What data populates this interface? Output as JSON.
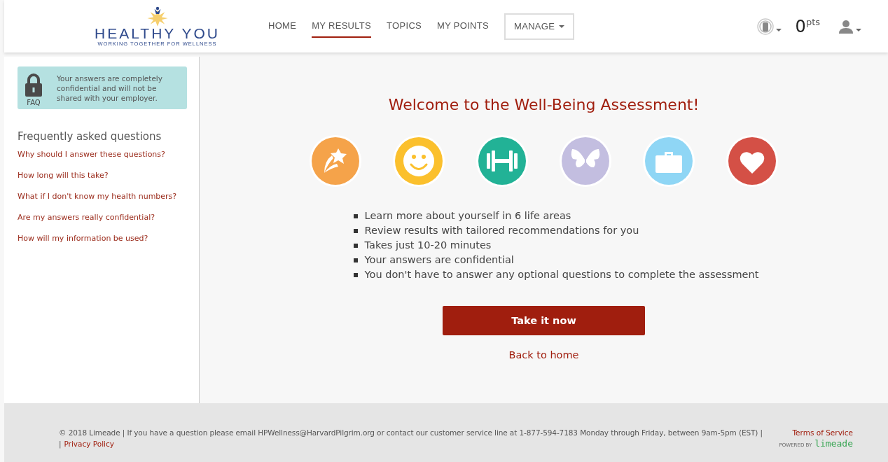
{
  "header": {
    "logo": {
      "title": "HEALTHY YOU",
      "tagline": "WORKING TOGETHER FOR WELLNESS"
    },
    "nav": [
      {
        "label": "HOME",
        "selected": false
      },
      {
        "label": "MY RESULTS",
        "selected": true
      },
      {
        "label": "TOPICS",
        "selected": false
      },
      {
        "label": "MY POINTS",
        "selected": false
      }
    ],
    "manage_menu": {
      "label": "MANAGE"
    },
    "points": {
      "value": "0",
      "unit": "pts"
    }
  },
  "sidebar": {
    "notice": {
      "icon_label": "FAQ",
      "text": "Your answers are completely confidential and will not be shared with your employer."
    },
    "faq_title": "Frequently asked questions",
    "faq_links": [
      "Why should I answer these questions?",
      "How long will this take?",
      "What if I don't know my health numbers?",
      "Are my answers really confidential?",
      "How will my information be used?"
    ]
  },
  "main": {
    "title": "Welcome to the Well-Being Assessment!",
    "areas": [
      {
        "kind": "star",
        "color": "#f5a34a"
      },
      {
        "kind": "smiley",
        "color": "#fbc02d"
      },
      {
        "kind": "dumbbell",
        "color": "#22b296"
      },
      {
        "kind": "butterfly",
        "color": "#c3bee0"
      },
      {
        "kind": "briefcase",
        "color": "#8fd6f5"
      },
      {
        "kind": "heart",
        "color": "#d45046"
      }
    ],
    "bullets": [
      "Learn more about yourself in 6 life areas",
      "Review results with tailored recommendations for you",
      "Takes just 10-20 minutes",
      "Your answers are confidential",
      "You don't have to answer any optional questions to complete the assessment"
    ],
    "primary_button": "Take it now",
    "back_link": "Back to home"
  },
  "footer": {
    "text": "© 2018 Limeade  | If you have a question please email HPWellness@HarvardPilgrim.org or contact our customer service line at 1-877-594-7183 Monday through Friday, between 9am-5pm (EST) |",
    "terms_link": "Terms of Service",
    "separator": "|",
    "privacy_link": "Privacy Policy",
    "powered_by": "POWERED BY",
    "brand": "limeade"
  }
}
